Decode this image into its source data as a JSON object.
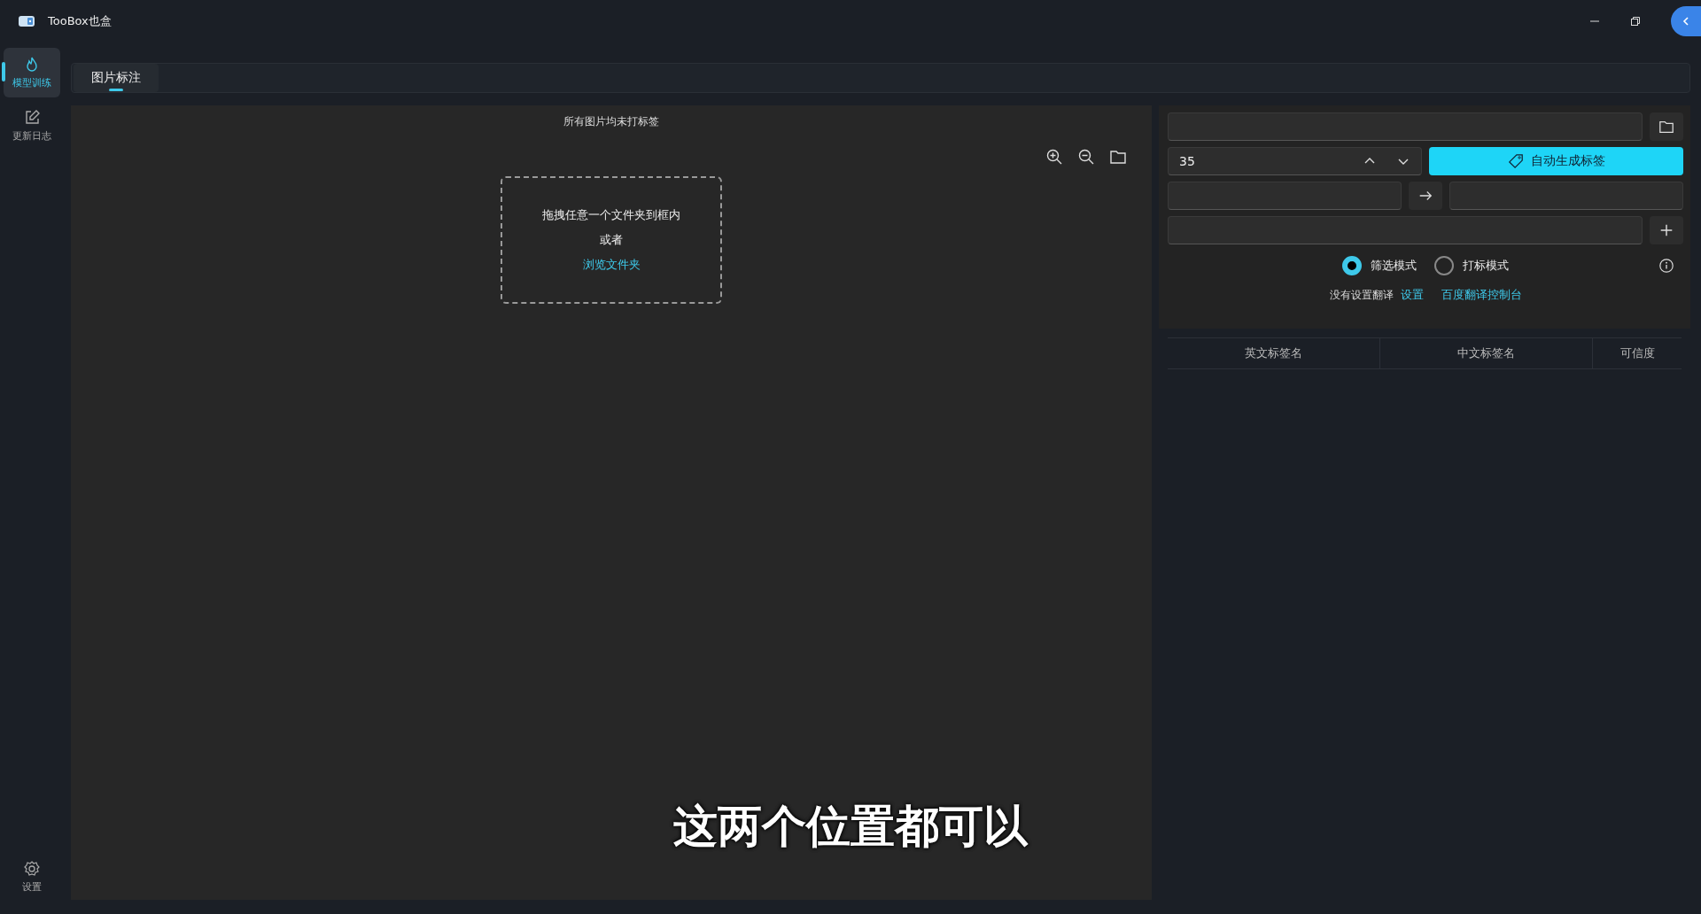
{
  "window": {
    "title": "TooBox也盒"
  },
  "sidebar": {
    "items": [
      {
        "label": "模型训练",
        "selected": true,
        "kind": "flame"
      },
      {
        "label": "更新日志",
        "selected": false,
        "kind": "edit"
      }
    ],
    "footer": {
      "label": "设置"
    }
  },
  "tabs": [
    {
      "label": "图片标注",
      "selected": true
    }
  ],
  "canvas": {
    "status": "所有图片均未打标签",
    "dropzone": {
      "prompt": "拖拽任意一个文件夹到框内",
      "or": "或者",
      "link": "浏览文件夹"
    }
  },
  "controls": {
    "threshold": {
      "value": "35"
    },
    "generate_button": "自动生成标签",
    "modes": [
      {
        "label": "筛选模式",
        "selected": true
      },
      {
        "label": "打标模式",
        "selected": false
      }
    ],
    "translate": {
      "notice": "没有设置翻译",
      "settings_link": "设置",
      "console_link": "百度翻译控制台"
    }
  },
  "table": {
    "columns": [
      "英文标签名",
      "中文标签名",
      "可信度"
    ]
  },
  "subtitle": "这两个位置都可以"
}
